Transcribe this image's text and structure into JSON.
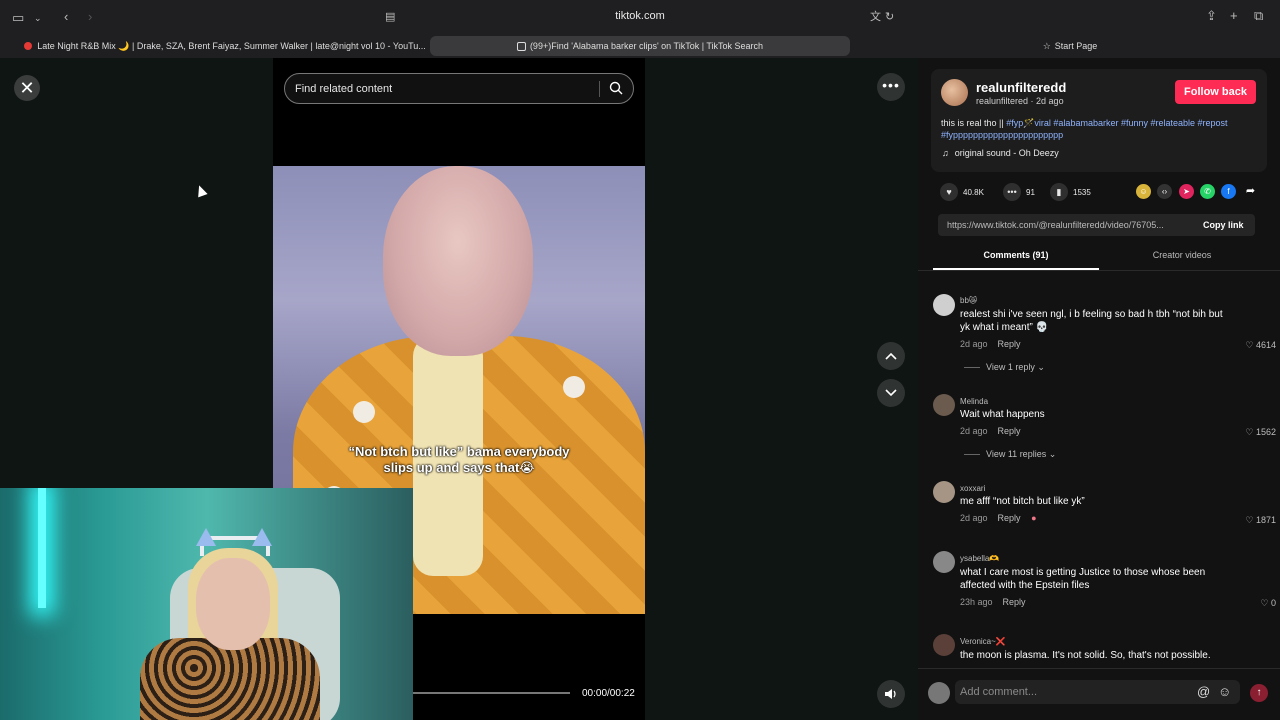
{
  "browser": {
    "url": "tiktok.com",
    "tabs": [
      {
        "label": "Late Night R&B Mix 🌙 | Drake, SZA, Brent Faiyaz, Summer Walker | late@night vol 10 - YouTu..."
      },
      {
        "label": "(99+)Find 'Alabama barker clips' on TikTok | TikTok Search"
      },
      {
        "label": "Start Page"
      }
    ]
  },
  "player": {
    "search_placeholder": "Find related content",
    "caption_line1": "“Not btch but like” bama everybody",
    "caption_line2": "slips up and says that😭",
    "time": "00:00/00:22",
    "progress": 0.02
  },
  "post": {
    "author": "realunfilteredd",
    "author_handle": "realunfiltered",
    "posted": "· 2d ago",
    "follow_label": "Follow back",
    "desc_plain": "this is real tho || ",
    "desc_tags": "#fyp🪄viral #alabamabarker #funny #relateable #repost #fypppppppppppppppppppppp",
    "sound": "original sound - Oh Deezy",
    "likes": "40.8K",
    "comments": "91",
    "saves": "1535",
    "link": "https://www.tiktok.com/@realunfilteredd/video/76705...",
    "copy_label": "Copy link",
    "tab_comments": "Comments (91)",
    "tab_creator": "Creator videos"
  },
  "comments": [
    {
      "user": "bb😿",
      "text": "realest shi i've seen ngl, i b feeling so bad h tbh “not bih but yk what i meant” 💀",
      "time": "2d ago",
      "reply": "Reply",
      "likes": "4614",
      "view": "View 1 reply"
    },
    {
      "user": "Melinda",
      "text": "Wait what happens",
      "time": "2d ago",
      "reply": "Reply",
      "likes": "1562",
      "view": "View 11 replies"
    },
    {
      "user": "xoxxari",
      "text": "me afff “not bitch but like yk”",
      "time": "2d ago",
      "reply": "Reply",
      "likes": "1871"
    },
    {
      "user": "ysabella🫶",
      "text": "what I care most is getting Justice to those whose been affected with the Epstein files",
      "time": "23h ago",
      "reply": "Reply",
      "likes": "0"
    },
    {
      "user": "Veronica~❌",
      "text": "the moon is plasma. It's not solid. So, that's not possible."
    }
  ],
  "comment_input": {
    "placeholder": "Add comment..."
  },
  "colors": {
    "accent": "#fe2c55",
    "link": "#8fb4ff",
    "panel": "#121212"
  }
}
